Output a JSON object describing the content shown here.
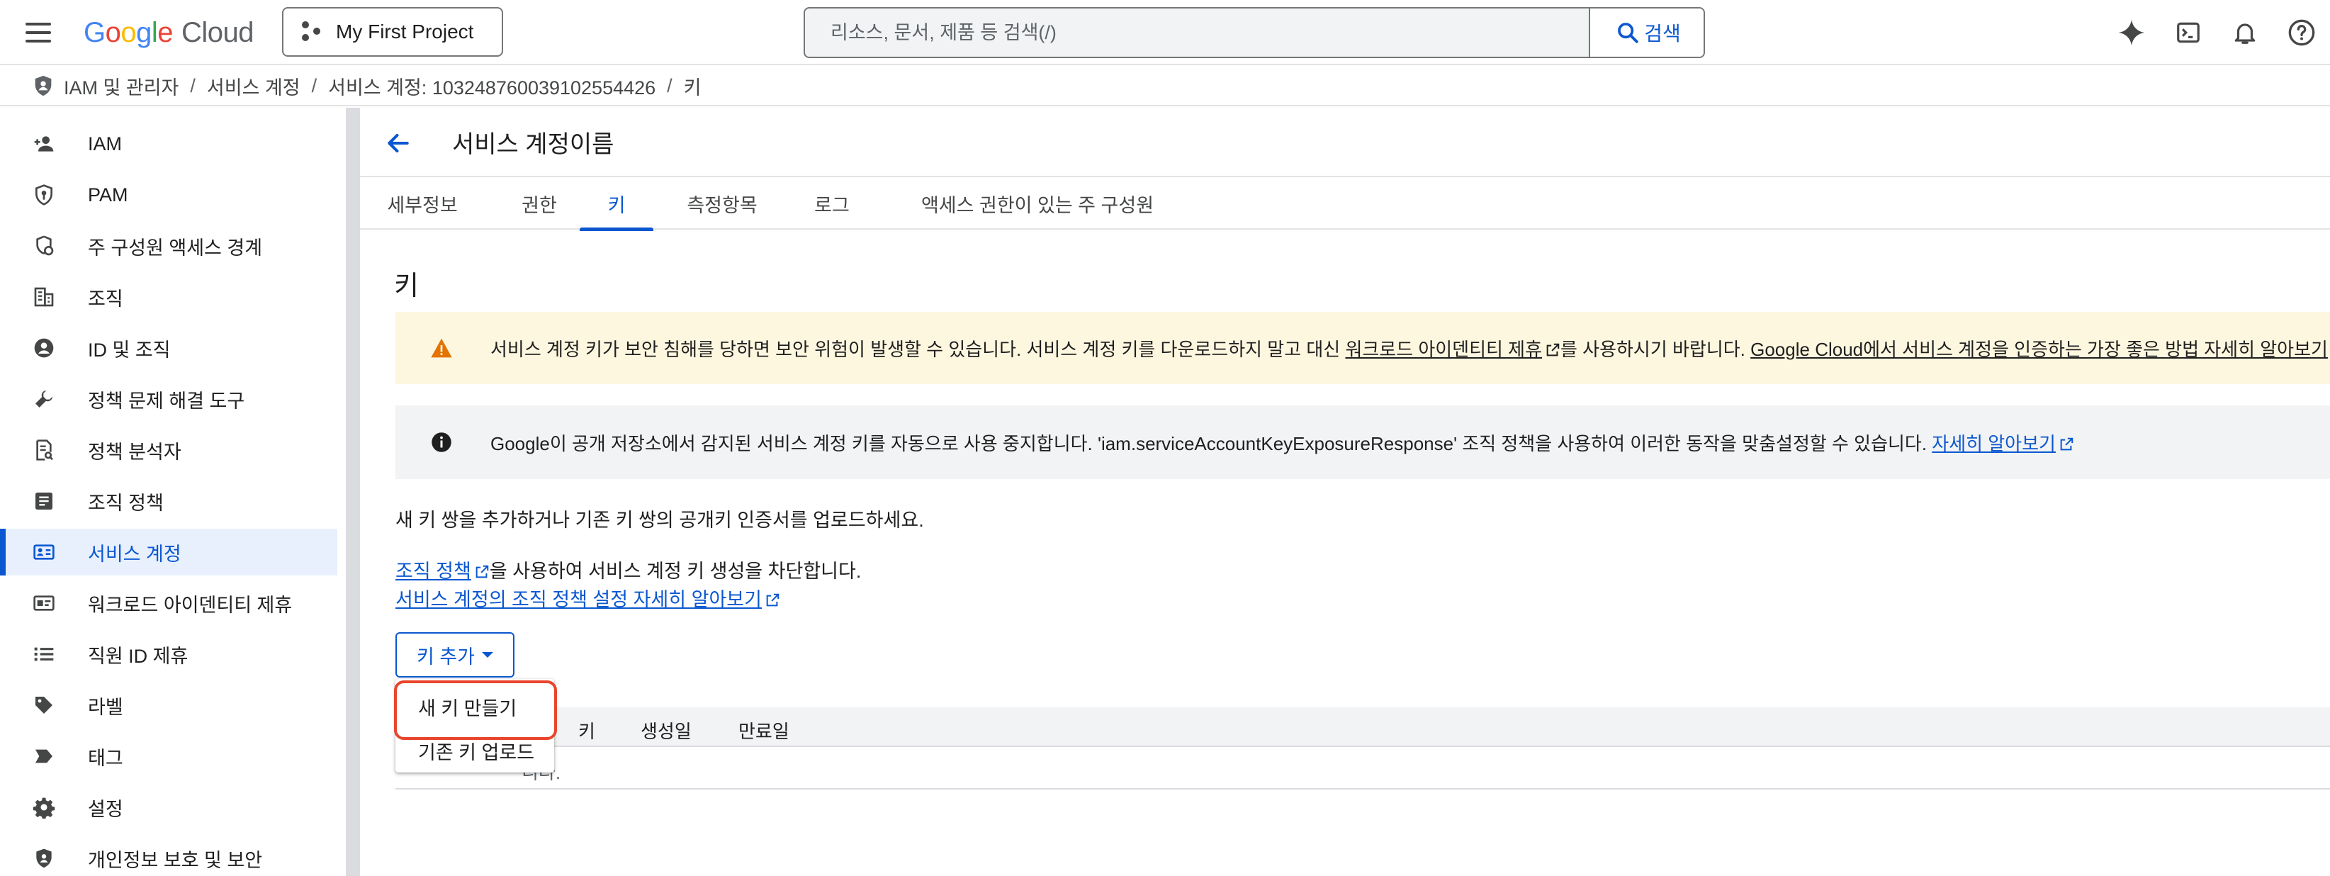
{
  "topbar": {
    "logo_letters": [
      "G",
      "o",
      "o",
      "g",
      "l",
      "e"
    ],
    "logo_product": "Cloud",
    "project_name": "My First Project",
    "search_placeholder": "리소스, 문서, 제품 등 검색(/)",
    "search_button": "검색",
    "icons": [
      "gemini-sparkle-icon",
      "cloud-shell-icon",
      "notifications-bell-icon",
      "help-icon"
    ]
  },
  "breadcrumb": {
    "items": [
      "IAM 및 관리자",
      "서비스 계정",
      "서비스 계정: 103248760039102554426",
      "키"
    ],
    "separator": "/"
  },
  "sidebar": {
    "items": [
      {
        "label": "IAM",
        "icon": "person-add-icon"
      },
      {
        "label": "PAM",
        "icon": "shield-key-icon"
      },
      {
        "label": "주 구성원 액세스 경계",
        "icon": "access-boundary-icon"
      },
      {
        "label": "조직",
        "icon": "building-icon"
      },
      {
        "label": "ID 및 조직",
        "icon": "account-circle-icon"
      },
      {
        "label": "정책 문제 해결 도구",
        "icon": "wrench-icon"
      },
      {
        "label": "정책 분석자",
        "icon": "policy-analyzer-icon"
      },
      {
        "label": "조직 정책",
        "icon": "article-icon"
      },
      {
        "label": "서비스 계정",
        "icon": "service-account-icon"
      },
      {
        "label": "워크로드 아이덴티티 제휴",
        "icon": "id-card-icon"
      },
      {
        "label": "직원 ID 제휴",
        "icon": "list-icon"
      },
      {
        "label": "라벨",
        "icon": "label-tag-icon"
      },
      {
        "label": "태그",
        "icon": "tag-icon"
      },
      {
        "label": "설정",
        "icon": "gear-icon"
      },
      {
        "label": "개인정보 보호 및 보안",
        "icon": "privacy-shield-icon"
      }
    ],
    "active_index": 8
  },
  "main": {
    "title": "서비스 계정이름",
    "tabs": [
      "세부정보",
      "권한",
      "키",
      "측정항목",
      "로그",
      "액세스 권한이 있는 주 구성원"
    ],
    "active_tab": 2,
    "section_title": "키",
    "warning": {
      "text1": "서비스 계정 키가 보안 침해를 당하면 보안 위험이 발생할 수 있습니다. 서비스 계정 키를 다운로드하지 말고 대신 ",
      "link1": "워크로드 아이덴티티 제휴",
      "text2": "를 사용하시기 바랍니다. ",
      "link2": "Google Cloud에서 서비스 계정을 인증하는 가장 좋은 방법 자세히 알아보기"
    },
    "info": {
      "text": "Google이 공개 저장소에서 감지된 서비스 계정 키를 자동으로 사용 중지합니다. 'iam.serviceAccountKeyExposureResponse' 조직 정책을 사용하여 이러한 동작을 맞춤설정할 수 있습니다. ",
      "link": "자세히 알아보기"
    },
    "intro": "새 키 쌍을 추가하거나 기존 키 쌍의 공개키 인증서를 업로드하세요.",
    "policy_link": "조직 정책",
    "policy_text": "을 사용하여 서비스 계정 키 생성을 차단합니다.",
    "policy_learn_link": "서비스 계정의 조직 정책 설정 자세히 알아보기",
    "add_key_button": "키 추가",
    "table_headers": [
      "키",
      "생성일",
      "만료일"
    ],
    "empty_text_visible": "니다.",
    "dropdown_items": [
      "새 키 만들기",
      "기존 키 업로드"
    ]
  },
  "colors": {
    "accent": "#0b57d0",
    "warning_bg": "#fef7e0",
    "warning_icon": "#e37400",
    "info_bg": "#f1f3f4",
    "highlight": "#e8452c",
    "sidebar_active_bg": "#e8f0fe"
  }
}
